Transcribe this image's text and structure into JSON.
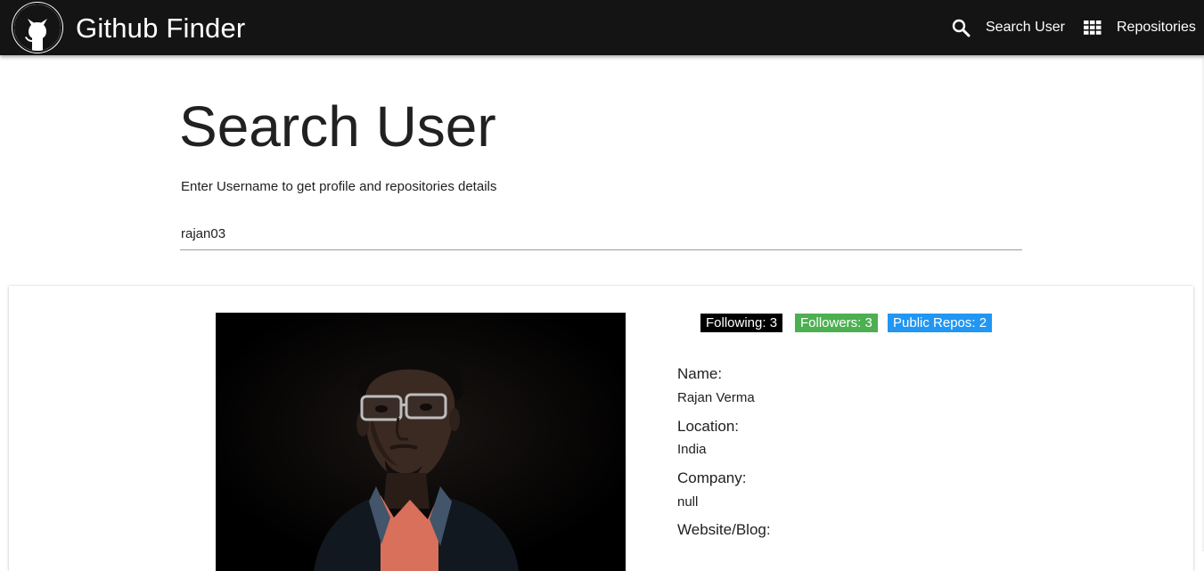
{
  "header": {
    "title": "Github Finder",
    "logo_icon": "github-octocat-icon",
    "nav": [
      {
        "label": "Search User",
        "icon": "search-icon"
      },
      {
        "label": "Repositories",
        "icon": "grid-icon"
      }
    ]
  },
  "search": {
    "title": "Search User",
    "subtitle": "Enter Username to get profile and repositories details",
    "input_value": "rajan03"
  },
  "profile": {
    "badges": {
      "following": "Following: 3",
      "followers": "Followers: 3",
      "public_repos": "Public Repos: 2"
    },
    "details": [
      {
        "label": "Name:",
        "value": "Rajan Verma"
      },
      {
        "label": "Location:",
        "value": "India"
      },
      {
        "label": "Company:",
        "value": "null"
      },
      {
        "label": "Website/Blog:",
        "value": ""
      }
    ]
  },
  "colors": {
    "navbar": "#151414",
    "following_badge": "#000000",
    "followers_badge": "#4caf50",
    "repos_badge": "#2196f3"
  }
}
